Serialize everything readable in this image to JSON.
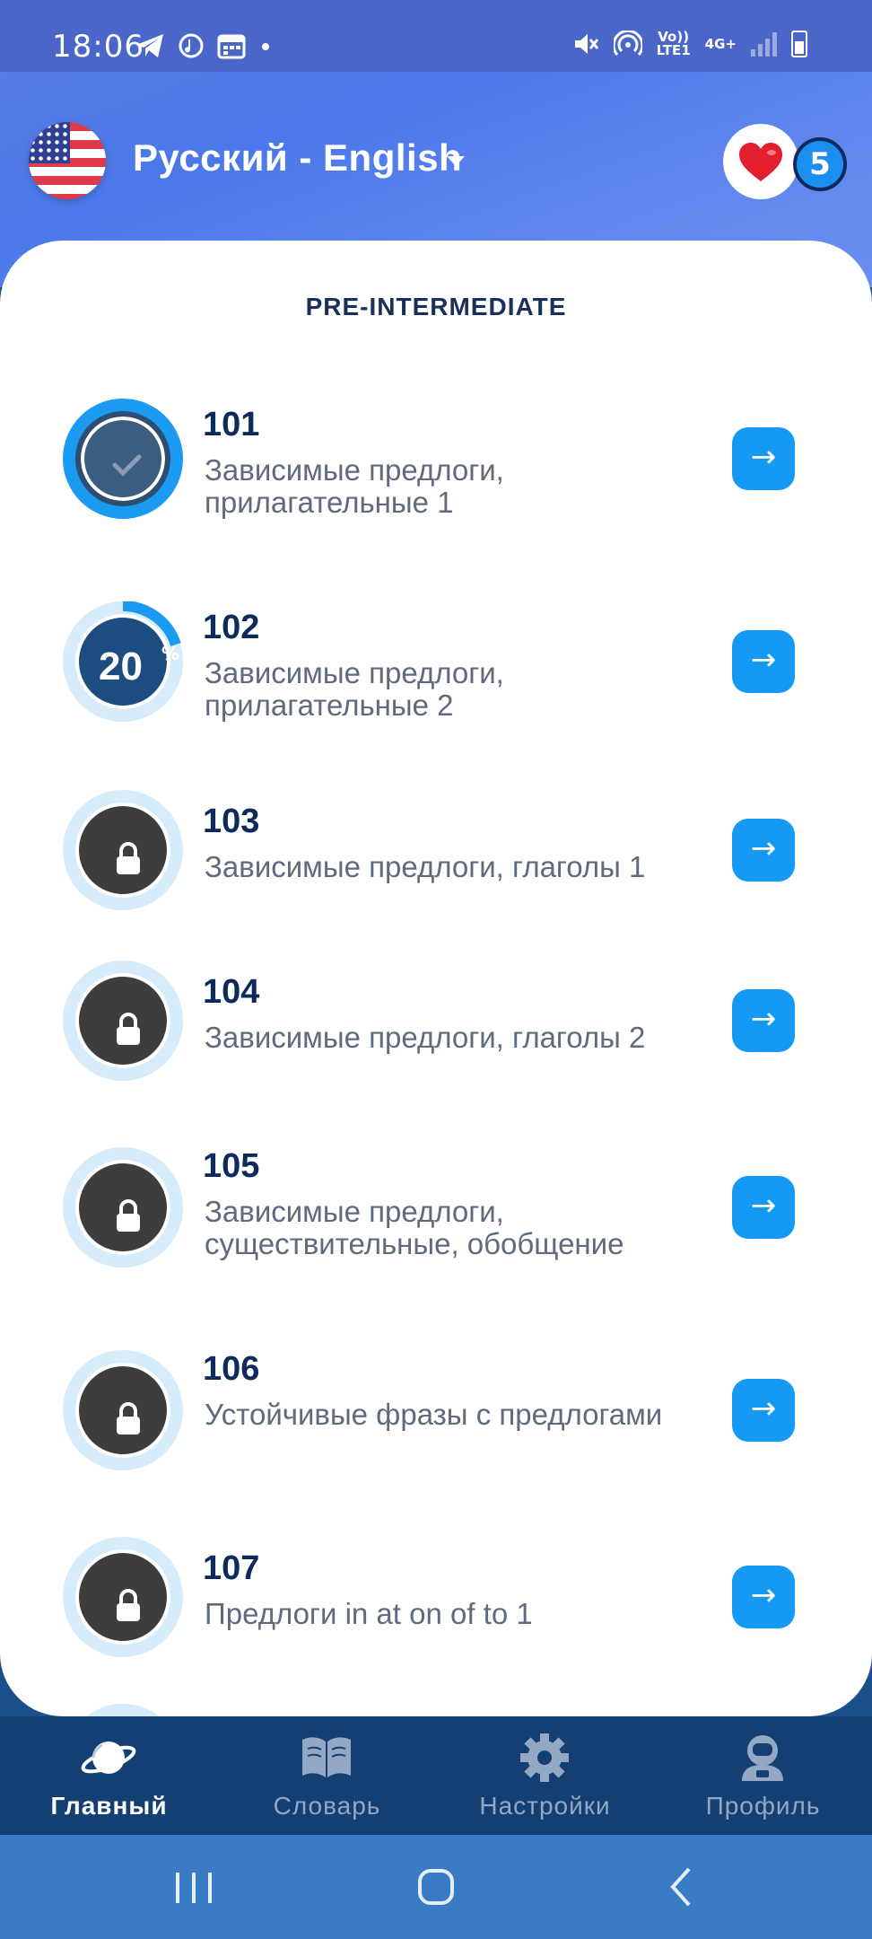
{
  "status_bar": {
    "time": "18:06",
    "lte_top": "Vo))",
    "lte_bottom": "LTE1",
    "net": "4G+"
  },
  "header": {
    "language_pair": "Русский - English",
    "lives": "5",
    "colors": {
      "heart": "#e21f2f",
      "accent": "#149af2"
    }
  },
  "level": {
    "title": "PRE-INTERMEDIATE"
  },
  "lessons": [
    {
      "number": "101",
      "title": "Зависимые предлоги, прилагательные 1",
      "state": "completed",
      "icon": "check-icon"
    },
    {
      "number": "102",
      "title": "Зависимые предлоги, прилагательные 2",
      "state": "in-progress",
      "progress": "20",
      "progress_sign": "%"
    },
    {
      "number": "103",
      "title": "Зависимые предлоги, глаголы 1",
      "state": "locked",
      "icon": "lock-icon"
    },
    {
      "number": "104",
      "title": "Зависимые предлоги, глаголы 2",
      "state": "locked",
      "icon": "lock-icon"
    },
    {
      "number": "105",
      "title": "Зависимые предлоги, существительные, обобщение",
      "state": "locked",
      "icon": "lock-icon"
    },
    {
      "number": "106",
      "title": "Устойчивые фразы с предлогами",
      "state": "locked",
      "icon": "lock-icon"
    },
    {
      "number": "107",
      "title": "Предлоги in at on of to 1",
      "state": "locked",
      "icon": "lock-icon"
    }
  ],
  "bottom_nav": [
    {
      "label": "Главный",
      "icon": "planet-icon",
      "active": true
    },
    {
      "label": "Словарь",
      "icon": "book-icon",
      "active": false
    },
    {
      "label": "Настройки",
      "icon": "gear-icon",
      "active": false
    },
    {
      "label": "Профиль",
      "icon": "astronaut-icon",
      "active": false
    }
  ]
}
